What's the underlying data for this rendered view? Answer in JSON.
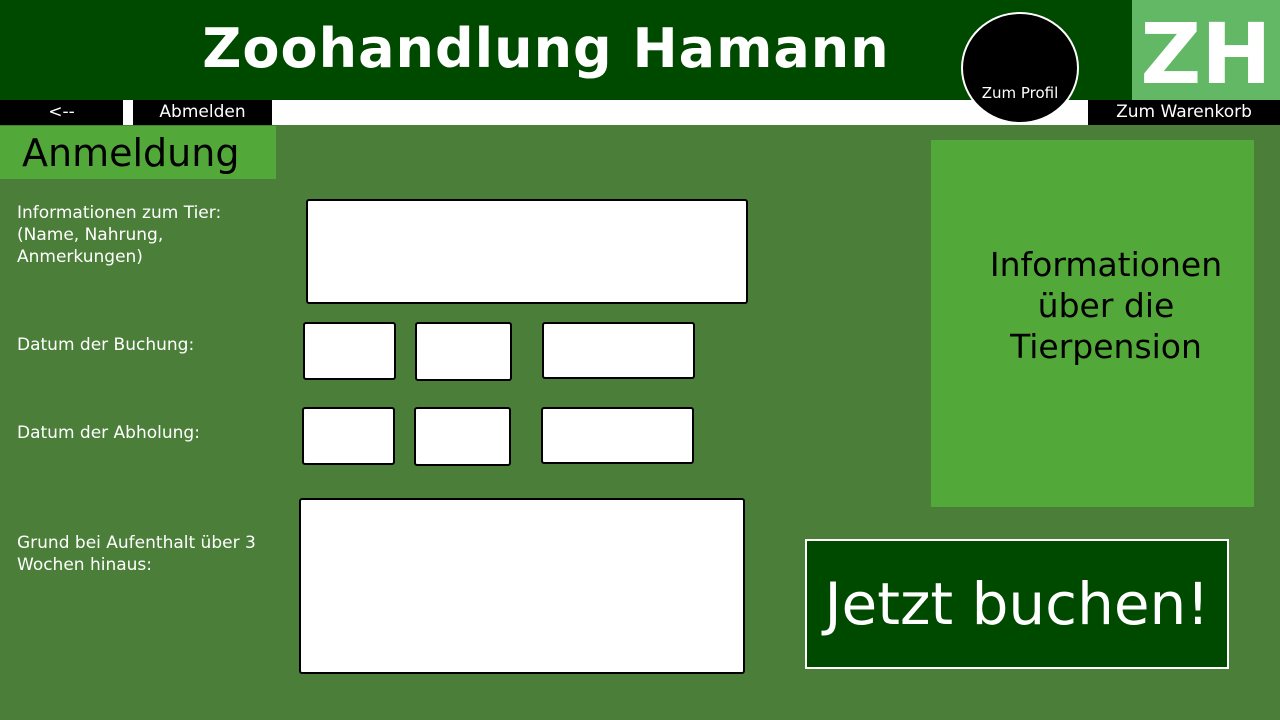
{
  "header": {
    "title": "Zoohandlung Hamann",
    "logo_text": "ZH",
    "profile_label": "Zum Profil"
  },
  "nav": {
    "back_label": "<--",
    "logout_label": "Abmelden",
    "cart_label": "Zum Warenkorb"
  },
  "page_title": "Anmeldung",
  "form": {
    "animal_info_label": "Informationen zum Tier:\n(Name, Nahrung,\nAnmerkungen)",
    "animal_info_value": "",
    "booking_date_label": "Datum der Buchung:",
    "booking_day": "",
    "booking_month": "",
    "booking_year": "",
    "pickup_date_label": "Datum der Abholung:",
    "pickup_day": "",
    "pickup_month": "",
    "pickup_year": "",
    "reason_label": "Grund bei Aufenthalt über 3\nWochen hinaus:",
    "reason_value": ""
  },
  "info_panel": {
    "text": "Informationen\nüber die\nTierpension"
  },
  "book_button_label": "Jetzt buchen!",
  "colors": {
    "header_bg": "#004a00",
    "page_bg": "#4a7e39",
    "accent_green": "#52a838",
    "logo_bg": "#62b864"
  }
}
